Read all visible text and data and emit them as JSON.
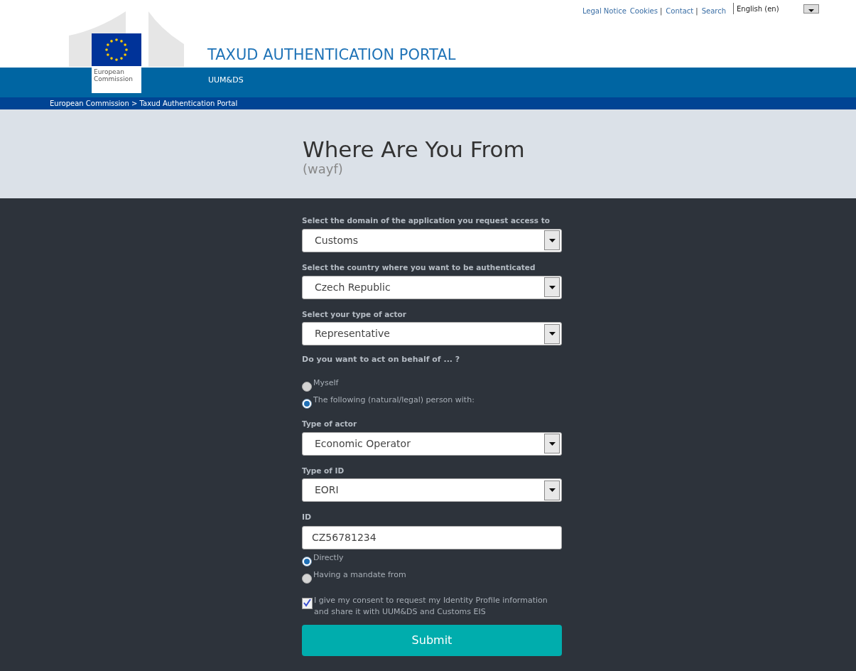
{
  "top_links": [
    {
      "kind": "link",
      "text": "Legal Notice"
    },
    {
      "kind": "link",
      "text": "Cookies"
    },
    {
      "kind": "separator",
      "text": "|"
    },
    {
      "kind": "link",
      "text": "Contact"
    },
    {
      "kind": "separator",
      "text": "|"
    },
    {
      "kind": "link",
      "text": "Search"
    }
  ],
  "language": {
    "value": "English (en)"
  },
  "logo": {
    "text": "European Commission"
  },
  "header": {
    "title": "TAXUD AUTHENTICATION PORTAL",
    "subtitle": "UUM&DS"
  },
  "breadcrumb": {
    "text": "European Commission > Taxud Authentication Portal"
  },
  "page": {
    "title": "Where Are You From",
    "subtitle": "(wayf)"
  },
  "form": {
    "items": [
      {
        "kind": "select",
        "label": "Select the domain of the application you request access to",
        "value": "Customs"
      },
      {
        "kind": "select",
        "label": "Select the country where you want to be authenticated",
        "value": "Czech Republic"
      },
      {
        "kind": "select",
        "label": "Select your type of actor",
        "value": "Representative"
      },
      {
        "kind": "question",
        "text": "Do you want to act on behalf of ... ?"
      },
      {
        "kind": "radio",
        "label": "Myself",
        "selected": false
      },
      {
        "kind": "radio",
        "label": "The following (natural/legal) person with:",
        "selected": true
      },
      {
        "kind": "select",
        "label": "Type of actor",
        "value": "Economic Operator"
      },
      {
        "kind": "select",
        "label": "Type of ID",
        "value": "EORI"
      },
      {
        "kind": "input",
        "label": "ID",
        "value": "CZ56781234"
      },
      {
        "kind": "radio",
        "label": "Directly",
        "selected": true
      },
      {
        "kind": "radio",
        "label": "Having a mandate from",
        "selected": false
      },
      {
        "kind": "checkbox",
        "label": "I give my consent to request my Identity Profile information and share it with UUM&DS and Customs EIS",
        "checked": true
      }
    ],
    "submit": "Submit"
  }
}
